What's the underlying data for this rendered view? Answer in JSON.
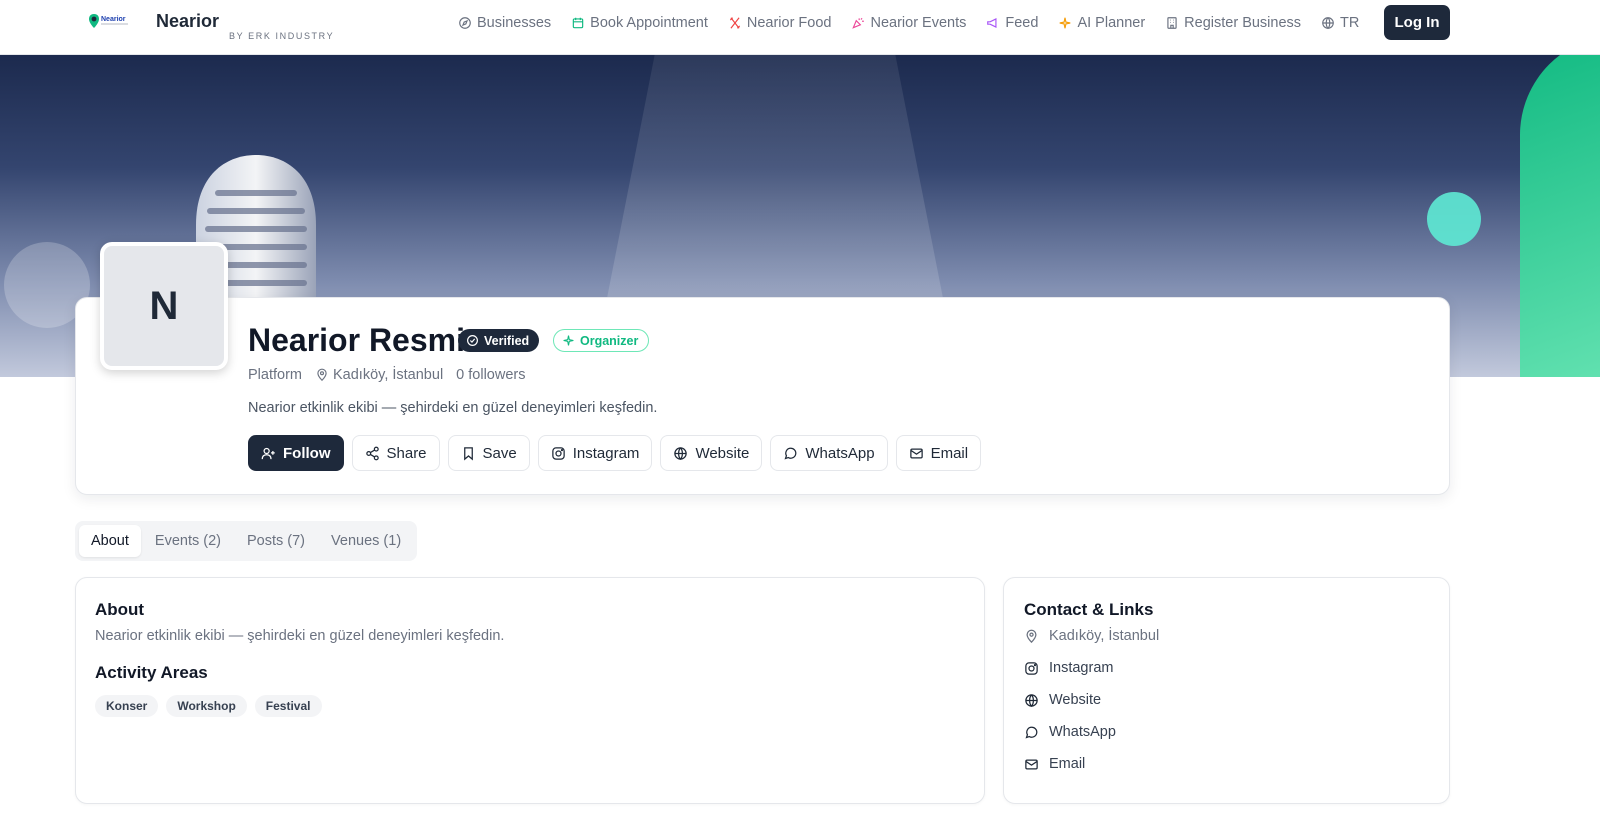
{
  "brand": {
    "name": "Nearior",
    "subtitle": "BY ERK INDUSTRY",
    "logo_text": "Nearior"
  },
  "nav": [
    {
      "label": "Businesses",
      "icon": "compass-icon",
      "color": "#6b7280"
    },
    {
      "label": "Book Appointment",
      "icon": "calendar-icon",
      "color": "#10b981"
    },
    {
      "label": "Nearior Food",
      "icon": "utensils-icon",
      "color": "#ef4444"
    },
    {
      "label": "Nearior Events",
      "icon": "party-popper-icon",
      "color": "#ec4899"
    },
    {
      "label": "Feed",
      "icon": "megaphone-icon",
      "color": "#a855f7"
    },
    {
      "label": "AI Planner",
      "icon": "sparkles-icon",
      "color": "#f59e0b"
    },
    {
      "label": "Register Business",
      "icon": "building-icon",
      "color": "#6b7280"
    },
    {
      "label": "TR",
      "icon": "globe-icon",
      "color": "#6b7280"
    }
  ],
  "login_label": "Log In",
  "profile": {
    "avatar_letter": "N",
    "name": "Nearior Resmi",
    "verified_label": "Verified",
    "organizer_label": "Organizer",
    "category": "Platform",
    "location": "Kadıköy, İstanbul",
    "followers": "0 followers",
    "bio": "Nearior etkinlik ekibi — şehirdeki en güzel deneyimleri keşfedin."
  },
  "actions": {
    "follow": "Follow",
    "share": "Share",
    "save": "Save",
    "instagram": "Instagram",
    "website": "Website",
    "whatsapp": "WhatsApp",
    "email": "Email"
  },
  "tabs": [
    {
      "label": "About",
      "active": true
    },
    {
      "label": "Events (2)",
      "active": false
    },
    {
      "label": "Posts (7)",
      "active": false
    },
    {
      "label": "Venues (1)",
      "active": false
    }
  ],
  "about": {
    "title": "About",
    "text": "Nearior etkinlik ekibi — şehirdeki en güzel deneyimleri keşfedin.",
    "areas_title": "Activity Areas",
    "areas": [
      "Konser",
      "Workshop",
      "Festival"
    ]
  },
  "contact": {
    "title": "Contact & Links",
    "location": "Kadıköy, İstanbul",
    "instagram": "Instagram",
    "website": "Website",
    "whatsapp": "WhatsApp",
    "email": "Email"
  },
  "colors": {
    "primary": "#1e293b",
    "accent_green": "#10b981",
    "muted_text": "#6b7280"
  }
}
